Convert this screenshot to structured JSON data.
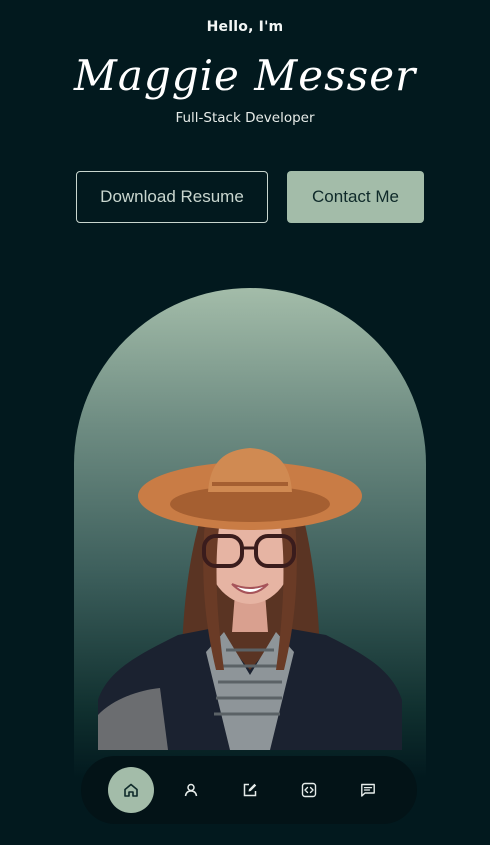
{
  "hero": {
    "greeting": "Hello, I'm",
    "name": "Maggie Messer",
    "role": "Full-Stack Developer"
  },
  "actions": {
    "download_label": "Download Resume",
    "contact_label": "Contact Me"
  },
  "nav": {
    "items": [
      {
        "icon": "home-icon",
        "active": true
      },
      {
        "icon": "user-icon",
        "active": false
      },
      {
        "icon": "edit-icon",
        "active": false
      },
      {
        "icon": "code-icon",
        "active": false
      },
      {
        "icon": "message-icon",
        "active": false
      }
    ]
  },
  "colors": {
    "background": "#02191e",
    "accent": "#a3bca9",
    "nav_background": "#031317"
  }
}
